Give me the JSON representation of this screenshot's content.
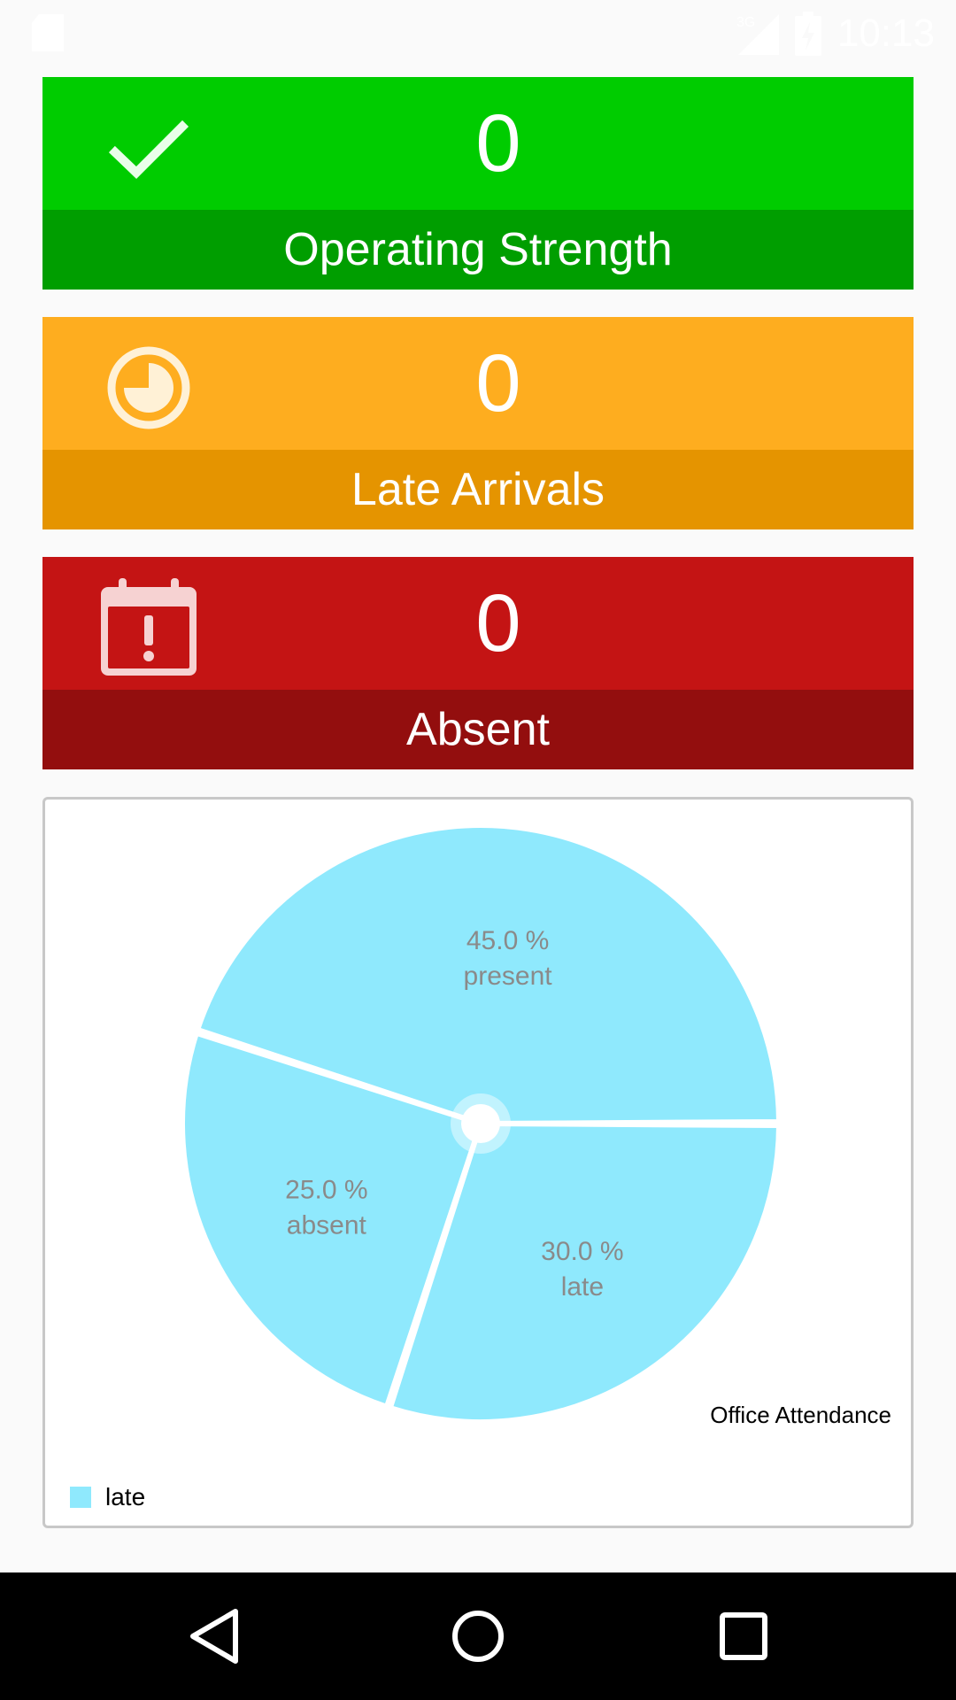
{
  "status_bar": {
    "time": "10:13",
    "network_label": "3G",
    "icons": [
      "sd-card-icon",
      "signal-icon",
      "battery-icon"
    ]
  },
  "cards": [
    {
      "id": "operating",
      "value": "0",
      "label": "Operating Strength",
      "icon": "checkmark-icon",
      "top_color": "#00cc00",
      "bottom_color": "#009e00"
    },
    {
      "id": "late",
      "value": "0",
      "label": "Late Arrivals",
      "icon": "clock-icon",
      "top_color": "#fead1f",
      "bottom_color": "#e59400"
    },
    {
      "id": "absent",
      "value": "0",
      "label": "Absent",
      "icon": "calendar-alert-icon",
      "top_color": "#c41414",
      "bottom_color": "#930e0e"
    }
  ],
  "chart_data": {
    "type": "pie",
    "slices": [
      {
        "label": "present",
        "value": 45.0,
        "text": "45.0 %"
      },
      {
        "label": "late",
        "value": 30.0,
        "text": "30.0 %"
      },
      {
        "label": "absent",
        "value": 25.0,
        "text": "25.0 %"
      }
    ],
    "slice_color": "#8fe9fd",
    "label_color": "#8a8a8a",
    "description": "Office Attendance",
    "legend": [
      {
        "label": "late",
        "color": "#8fe9fd"
      }
    ],
    "legend_position": "bottom-left"
  },
  "nav_bar": {
    "buttons": [
      "back-icon",
      "home-icon",
      "recents-icon"
    ]
  }
}
